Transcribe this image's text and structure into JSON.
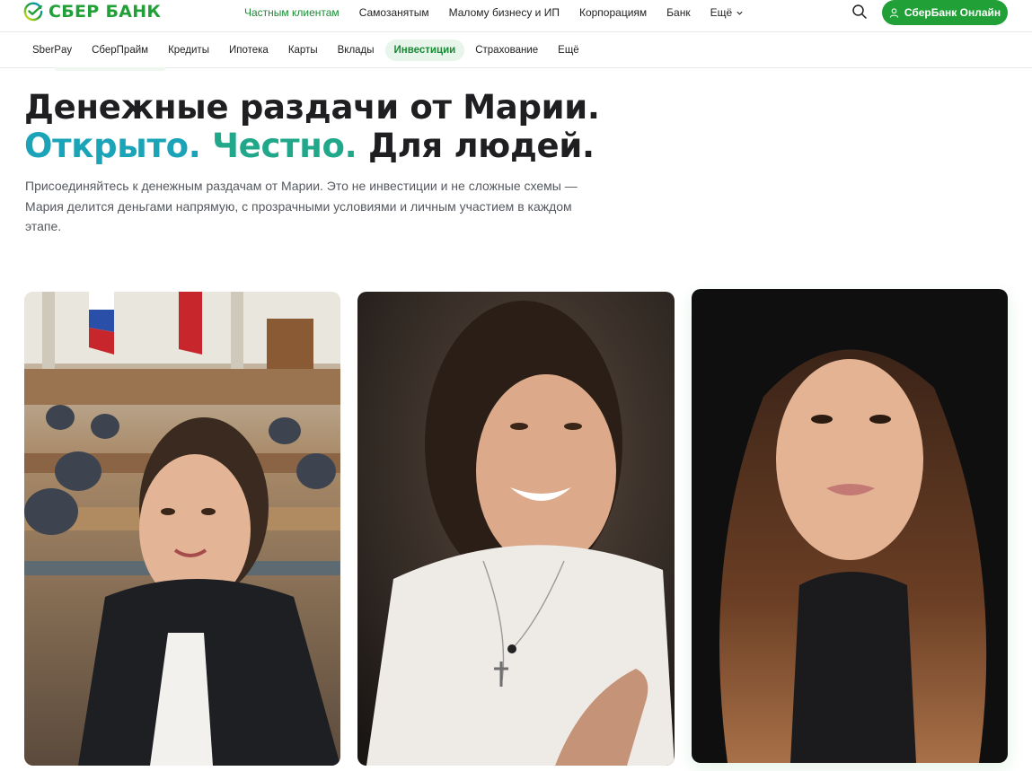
{
  "header": {
    "brand": "СБЕР БАНК",
    "nav": [
      {
        "label": "Частным клиентам",
        "active": true
      },
      {
        "label": "Самозанятым",
        "active": false
      },
      {
        "label": "Малому бизнесу и ИП",
        "active": false
      },
      {
        "label": "Корпорациям",
        "active": false
      },
      {
        "label": "Банк",
        "active": false
      }
    ],
    "more_label": "Ещё",
    "login_label": "СберБанк Онлайн",
    "accent_color": "#21a038"
  },
  "subnav": {
    "items": [
      {
        "label": "SberPay",
        "active": false
      },
      {
        "label": "СберПрайм",
        "active": false
      },
      {
        "label": "Кредиты",
        "active": false
      },
      {
        "label": "Ипотека",
        "active": false
      },
      {
        "label": "Карты",
        "active": false
      },
      {
        "label": "Вклады",
        "active": false
      },
      {
        "label": "Инвестиции",
        "active": true
      },
      {
        "label": "Страхование",
        "active": false
      },
      {
        "label": "Ещё",
        "active": false
      }
    ]
  },
  "hero": {
    "title_line1": "Денежные раздачи от Марии.",
    "title_word_blue": "Открыто.",
    "title_word_green": "Честно.",
    "title_word_dark": "Для людей.",
    "description": "Присоединяйтесь к денежным раздачам от Марии. Это не инвестиции и не сложные схемы — Мария делится деньгами напрямую, с прозрачными условиями и личным участием в каждом этапе."
  },
  "gallery": [
    {
      "image": "photo-woman-in-parliament-hall"
    },
    {
      "image": "photo-woman-smiling-white-top"
    },
    {
      "image": "photo-woman-long-hair-portrait"
    }
  ],
  "icons": {
    "logo": "sber-logo-icon",
    "search": "search-icon",
    "user": "user-icon",
    "chevron": "chevron-down-icon"
  }
}
